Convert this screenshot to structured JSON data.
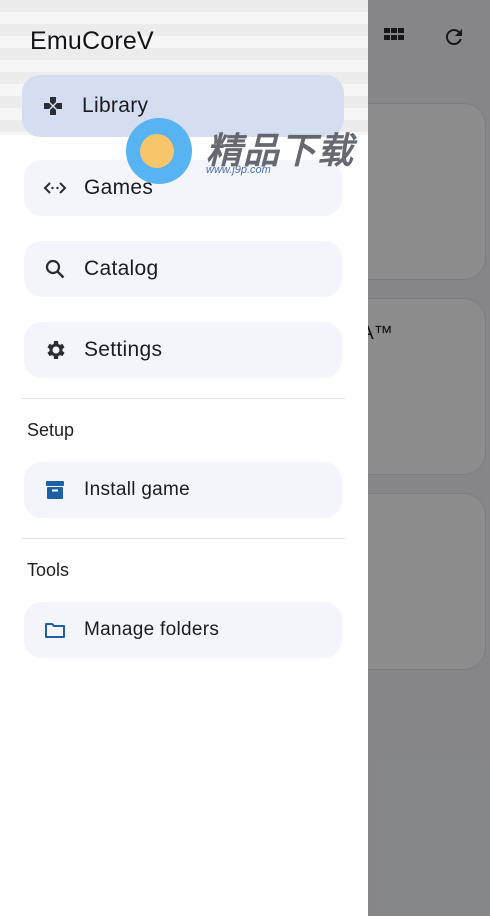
{
  "app": {
    "title": "EmuCoreV"
  },
  "topbar": {
    "icons": [
      "grid-view-icon",
      "refresh-icon"
    ]
  },
  "background": {
    "card_text": "A™"
  },
  "drawer": {
    "nav": [
      {
        "label": "Library",
        "icon": "gamepad-icon",
        "active": true
      },
      {
        "label": "Games",
        "icon": "code-arrows-icon",
        "active": false
      },
      {
        "label": "Catalog",
        "icon": "search-icon",
        "active": false
      },
      {
        "label": "Settings",
        "icon": "gear-icon",
        "active": false
      }
    ],
    "setup": {
      "title": "Setup",
      "items": [
        {
          "label": "Install game",
          "icon": "archive-box-icon"
        }
      ]
    },
    "tools": {
      "title": "Tools",
      "items": [
        {
          "label": "Manage folders",
          "icon": "folder-icon"
        }
      ]
    }
  },
  "watermark": {
    "text": "精品下载",
    "url": "www.j9p.com"
  },
  "colors": {
    "active_item": "#d4def0",
    "item_bg": "#f4f5fa",
    "accent_icon": "#1f5fa6",
    "scrim": "rgba(0,0,0,0.45)"
  }
}
